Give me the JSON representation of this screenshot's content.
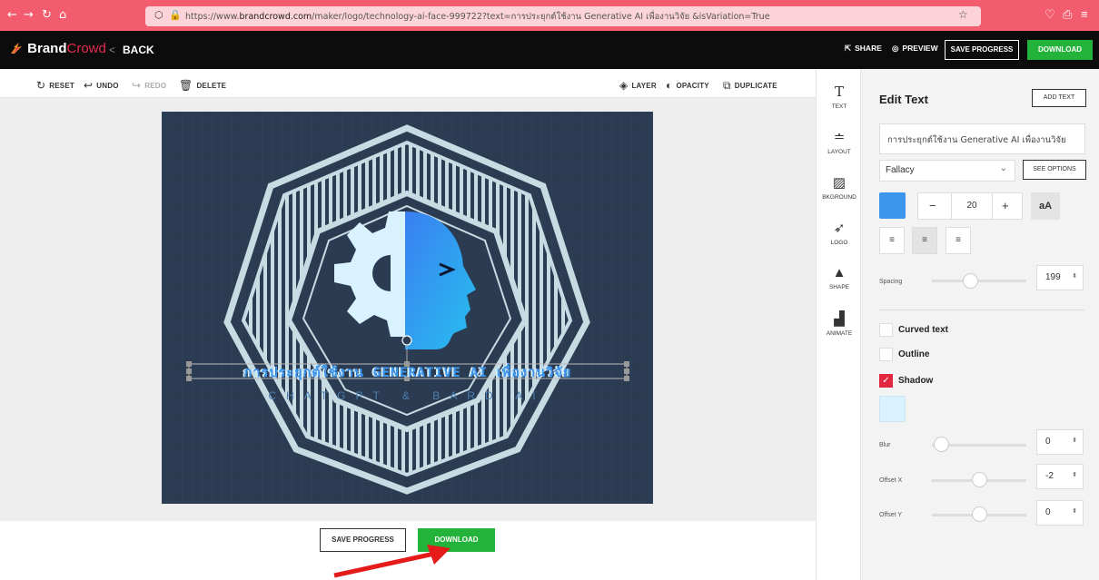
{
  "browser": {
    "url_prefix": "https://www.",
    "url_domain": "brandcrowd.com",
    "url_rest": "/maker/logo/technology-ai-face-999722?text=การประยุกต์ใช้งาน Generative AI เพื่องานวิจัย &isVariation=True"
  },
  "header": {
    "brand_part1": "Brand",
    "brand_part2": "Crowd",
    "back_label": "BACK",
    "share_label": "SHARE",
    "preview_label": "PREVIEW",
    "save_label": "SAVE PROGRESS",
    "download_label": "DOWNLOAD"
  },
  "toolbar": {
    "reset": "RESET",
    "undo": "UNDO",
    "redo": "REDO",
    "delete": "DELETE",
    "layer": "LAYER",
    "opacity": "OPACITY",
    "duplicate": "DUPLICATE"
  },
  "canvas": {
    "main_text": "การประยุกต์ใช้งาน GENERATIVE AI เพื่องานวิจัย",
    "sub_text": "CHATGPT & BARD AI"
  },
  "bottom": {
    "save_label": "SAVE PROGRESS",
    "download_label": "DOWNLOAD"
  },
  "tabs": [
    "TEXT",
    "LAYOUT",
    "BKGROUND",
    "LOGO",
    "SHAPE",
    "ANIMATE"
  ],
  "panel": {
    "title": "Edit Text",
    "add_text": "ADD TEXT",
    "text_value": "การประยุกต์ใช้งาน Generative AI เพื่องานวิจัย",
    "font": "Fallacy",
    "see_options": "SEE OPTIONS",
    "text_color": "#3d96ee",
    "size_minus": "−",
    "size_value": "20",
    "size_plus": "+",
    "case_toggle": "aA",
    "spacing_label": "Spacing",
    "spacing_value": "199",
    "curved_label": "Curved text",
    "outline_label": "Outline",
    "shadow_label": "Shadow",
    "shadow_checked": true,
    "shadow_color": "#d8f3ff",
    "blur_label": "Blur",
    "blur_value": "0",
    "offset_x_label": "Offset X",
    "offset_x_value": "-2",
    "offset_y_label": "Offset Y",
    "offset_y_value": "0"
  },
  "colors": {
    "browser_bar": "#f25c6e",
    "accent_green": "#23b23a",
    "canvas_bg": "#2b3b51",
    "checkbox_red": "#e3263f"
  }
}
